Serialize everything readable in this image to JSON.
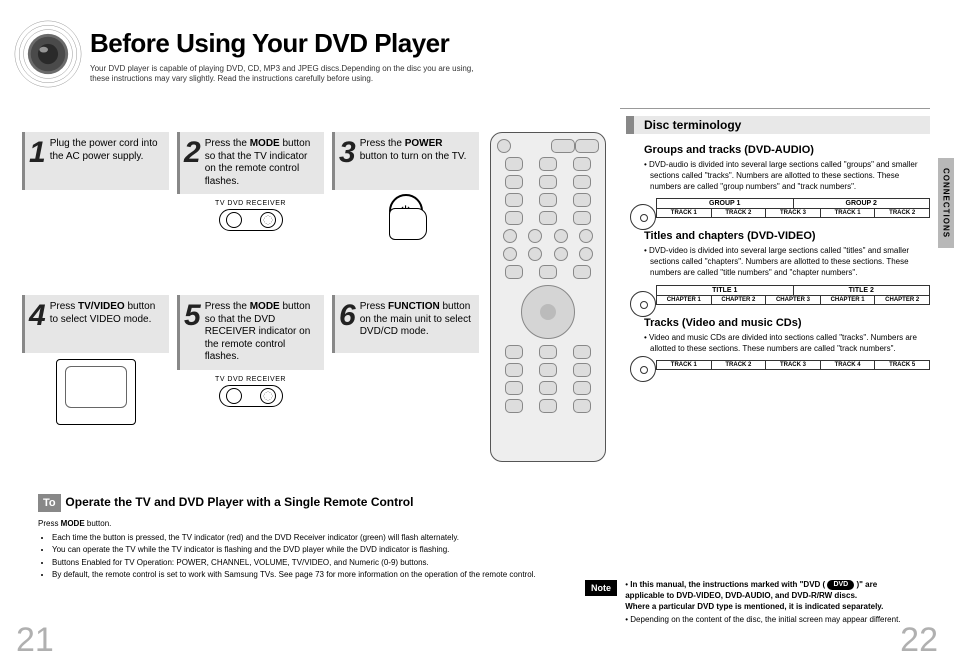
{
  "title": "Before Using Your DVD Player",
  "intro": "Your DVD player is capable of playing DVD, CD, MP3 and JPEG discs.Depending on the disc you are using, these instructions may vary slightly. Read the instructions carefully before using.",
  "side_tab": "CONNECTIONS",
  "steps": [
    {
      "num": "1",
      "html": "Plug the power cord into the AC power supply."
    },
    {
      "num": "2",
      "html": "Press the <b>MODE</b> button so that the TV indicator on the remote control flashes."
    },
    {
      "num": "3",
      "html": "Press the <b>POWER</b> button to turn on the TV."
    },
    {
      "num": "4",
      "html": "Press <b>TV/VIDEO</b> button to select VIDEO mode."
    },
    {
      "num": "5",
      "html": "Press the <b>MODE</b> button so that the DVD RECEIVER indicator on the remote control flashes."
    },
    {
      "num": "6",
      "html": "Press <b>FUNCTION</b> button on the main unit to select DVD/CD mode."
    }
  ],
  "switch_label": "TV    DVD RECEIVER",
  "switch_label2": "TV    DVD RECEIVER",
  "operate": {
    "to": "To",
    "title": "Operate the TV and DVD Player with a Single Remote Control",
    "first": "Press <b>MODE</b> button.",
    "bullets": [
      "Each time the button is pressed, the TV indicator (red) and the DVD Receiver indicator (green) will flash alternately.",
      "You can operate the TV while the TV indicator is flashing and the DVD player while the DVD indicator is flashing.",
      "Buttons Enabled for TV Operation: POWER, CHANNEL, VOLUME, TV/VIDEO, and Numeric (0-9) buttons.",
      "By default, the remote control is set to work with Samsung TVs. See page 73 for more information on the operation of the remote control."
    ]
  },
  "right": {
    "heading": "Disc terminology",
    "groups": {
      "title": "Groups and tracks (DVD-AUDIO)",
      "text": "DVD-audio is divided into several large sections called \"groups\" and smaller sections called \"tracks\". Numbers are allotted to these sections. These numbers are called \"group numbers\" and \"track numbers\".",
      "top_cells": [
        "GROUP 1",
        "GROUP 2"
      ],
      "cells": [
        "TRACK 1",
        "TRACK 2",
        "TRACK 3",
        "TRACK 1",
        "TRACK 2"
      ]
    },
    "titles": {
      "title": "Titles and chapters (DVD-VIDEO)",
      "text": "DVD-video is divided into several large sections called \"titles\" and smaller sections called \"chapters\". Numbers are allotted to these sections. These numbers are called \"title numbers\" and \"chapter numbers\".",
      "top_cells": [
        "TITLE 1",
        "TITLE 2"
      ],
      "cells": [
        "CHAPTER 1",
        "CHAPTER 2",
        "CHAPTER 3",
        "CHAPTER 1",
        "CHAPTER 2"
      ]
    },
    "tracks": {
      "title": "Tracks (Video and music CDs)",
      "text": "Video and music CDs are divided into sections called \"tracks\". Numbers are allotted to these sections. These numbers are called \"track numbers\".",
      "cells": [
        "TRACK 1",
        "TRACK 2",
        "TRACK 3",
        "TRACK 4",
        "TRACK 5"
      ]
    }
  },
  "note": {
    "badge": "Note",
    "line1a": "In this manual, the instructions marked with \"DVD (",
    "pill": "DVD",
    "line1b": ")\" are applicable to DVD-VIDEO, DVD-AUDIO, and DVD-R/RW discs.",
    "line2": "Where a particular DVD type is mentioned, it is indicated separately.",
    "sub": "Depending on the content of the disc, the initial screen may appear different."
  },
  "pages": {
    "left": "21",
    "right": "22"
  }
}
